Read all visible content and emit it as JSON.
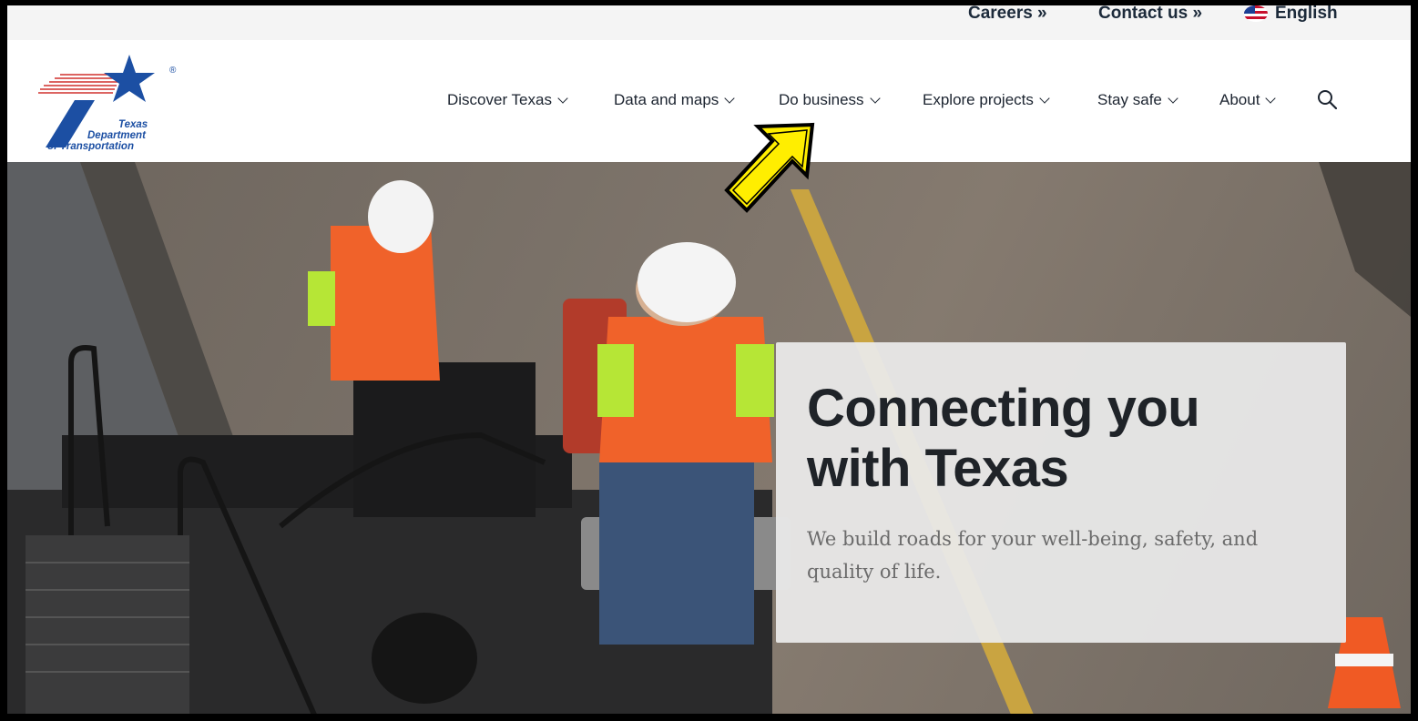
{
  "utility_bar": {
    "careers": "Careers »",
    "contact": "Contact us »",
    "language": "English"
  },
  "logo": {
    "line1": "Texas",
    "line2": "Department",
    "line3": "of Transportation",
    "registered": "®"
  },
  "nav": {
    "items": [
      {
        "label": "Discover Texas"
      },
      {
        "label": "Data and maps"
      },
      {
        "label": "Do business"
      },
      {
        "label": "Explore projects"
      },
      {
        "label": "Stay safe"
      },
      {
        "label": "About"
      }
    ]
  },
  "hero": {
    "title": "Connecting you with Texas",
    "subtitle": "We build roads for your well-being, safety, and quality of life."
  },
  "colors": {
    "brand_blue": "#1c4fa3",
    "brand_red": "#d0312d",
    "arrow_yellow": "#ffee00"
  }
}
